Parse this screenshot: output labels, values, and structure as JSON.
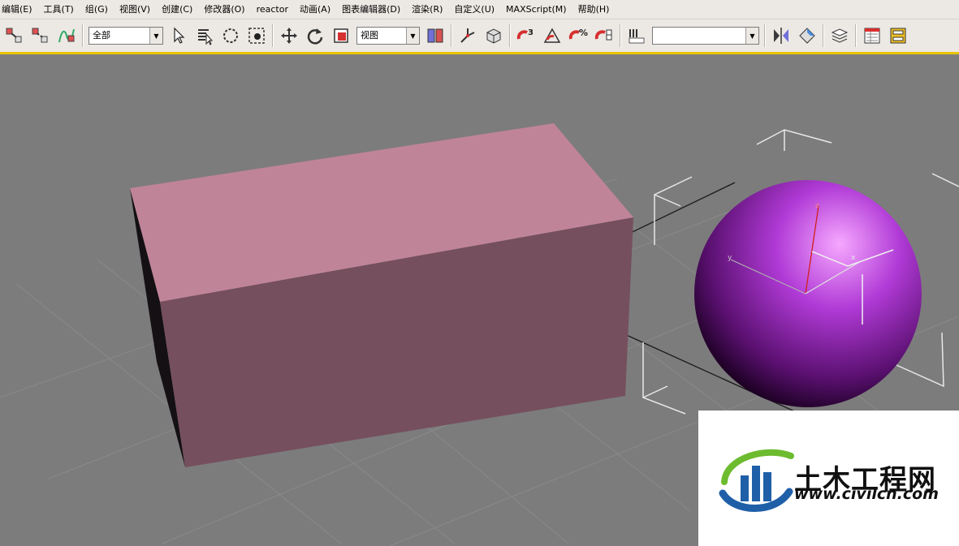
{
  "menu": [
    {
      "label": "编辑(E)"
    },
    {
      "label": "工具(T)"
    },
    {
      "label": "组(G)"
    },
    {
      "label": "视图(V)"
    },
    {
      "label": "创建(C)"
    },
    {
      "label": "修改器(O)"
    },
    {
      "label": "reactor"
    },
    {
      "label": "动画(A)"
    },
    {
      "label": "图表编辑器(D)"
    },
    {
      "label": "渲染(R)"
    },
    {
      "label": "自定义(U)"
    },
    {
      "label": "MAXScript(M)"
    },
    {
      "label": "帮助(H)"
    }
  ],
  "toolbar": {
    "selection_filter": "全部",
    "reference_coord": "视图",
    "named_selection": ""
  },
  "viewport": {
    "gizmo_labels": {
      "x": "x",
      "y": "y",
      "z": "z"
    }
  },
  "watermark": {
    "title": "土木工程网",
    "url": "www.civilcn.com",
    "colors": {
      "green": "#6dbb2f",
      "blue": "#1f5fa8"
    }
  },
  "colors": {
    "box_top": "#c08498",
    "box_front": "#754f5e",
    "box_left": "#141014",
    "sphere_highlight": "#f6a8ff",
    "sphere_mid": "#b03ad6",
    "sphere_dark": "#1a0020",
    "toolbar_accent": "#e8c400"
  }
}
